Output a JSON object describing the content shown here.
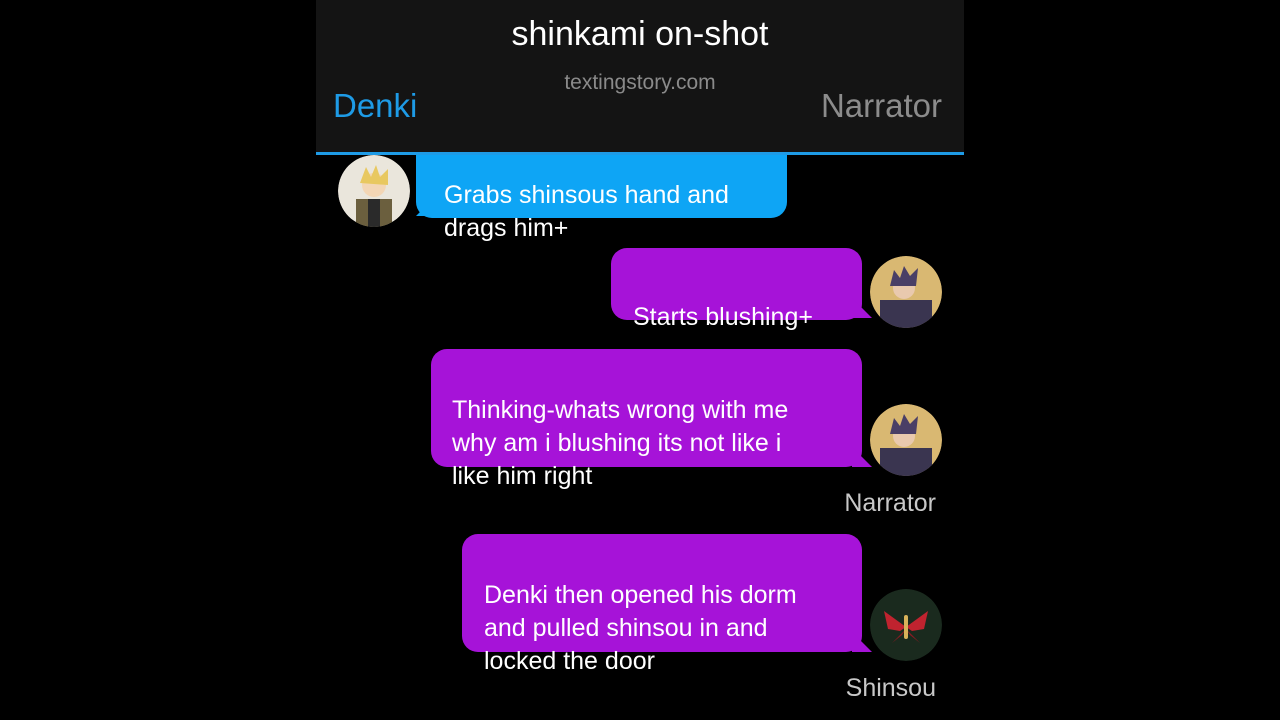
{
  "header": {
    "title": "shinkami on-shot",
    "watermark": "textingstory.com",
    "left_contact": "Denki",
    "right_contact": "Narrator"
  },
  "messages": [
    {
      "side": "left",
      "color": "blue",
      "avatar": "denki-avatar",
      "text": "Grabs shinsous hand and\ndrags him+"
    },
    {
      "side": "right",
      "color": "purple",
      "avatar": "narrator-avatar",
      "text": "Starts blushing+"
    },
    {
      "side": "right",
      "color": "purple",
      "avatar": "narrator-avatar",
      "text": "Thinking-whats wrong with me\nwhy am i blushing its not like i\nlike him right",
      "sender": "Narrator"
    },
    {
      "side": "right",
      "color": "purple",
      "avatar": "shinsou-avatar",
      "text": "Denki then opened his dorm\nand pulled shinsou in and\nlocked the door",
      "sender": "Shinsou"
    }
  ],
  "colors": {
    "accent_blue": "#1e9be6",
    "bubble_blue": "#0ea5f5",
    "bubble_purple": "#a613d8"
  }
}
